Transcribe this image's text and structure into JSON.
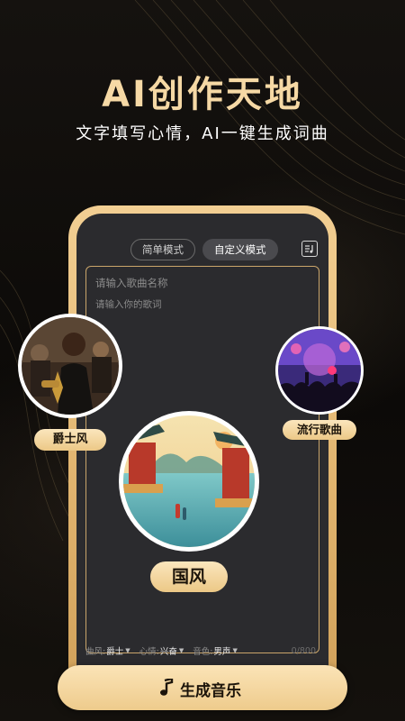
{
  "headline": "AI创作天地",
  "subheadline": "文字填写心情，AI一键生成词曲",
  "mode_tabs": [
    {
      "label": "简单模式",
      "active": false
    },
    {
      "label": "自定义模式",
      "active": true
    }
  ],
  "editor": {
    "title_placeholder": "请输入歌曲名称",
    "lyrics_placeholder": "请输入你的歌词"
  },
  "options": {
    "genre_label": "曲风:",
    "genre_value": "爵士",
    "mood_label": "心情:",
    "mood_value": "兴奋",
    "voice_label": "音色:",
    "voice_value": "男声",
    "char_count": "0/800"
  },
  "styles": {
    "jazz": "爵士风",
    "pop": "流行歌曲",
    "guofeng": "国风"
  },
  "generate_button": "生成音乐",
  "colors": {
    "accent_gold": "#e8c07e",
    "headline_gold": "#f6d9a5",
    "background": "#0d0b09"
  }
}
